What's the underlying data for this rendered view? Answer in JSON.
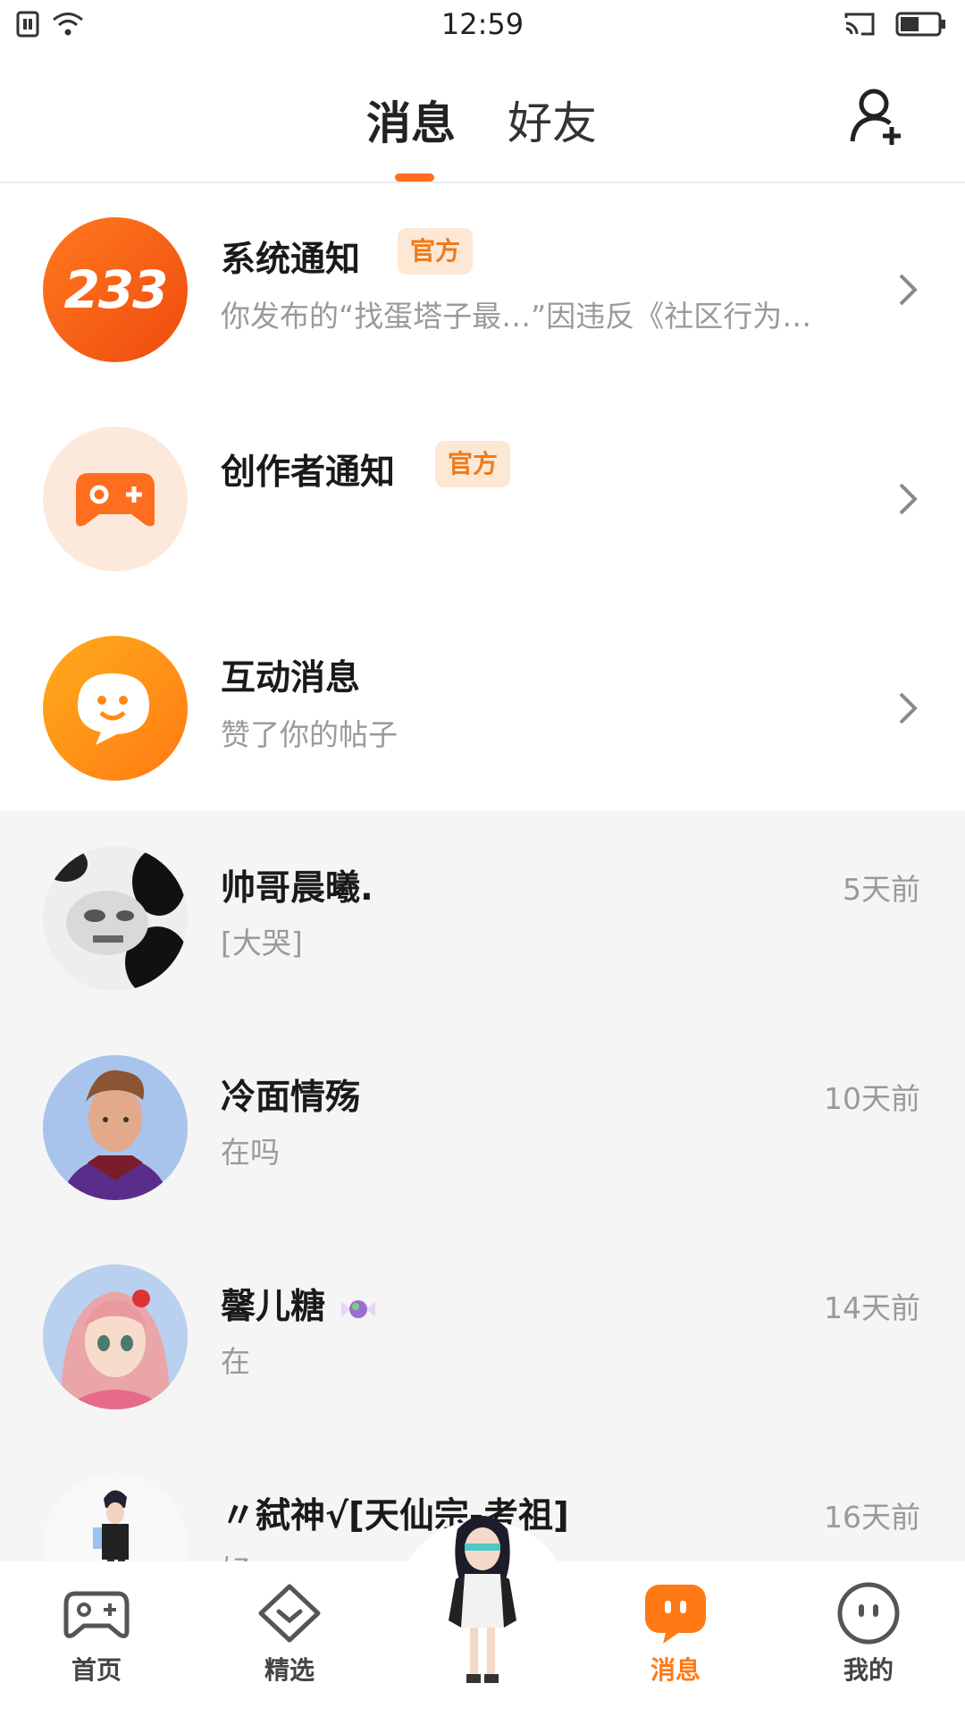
{
  "status_bar": {
    "time": "12:59"
  },
  "header": {
    "tabs": [
      {
        "label": "消息"
      },
      {
        "label": "好友"
      }
    ],
    "active_tab": "消息",
    "add_friend_icon": "add-user-icon"
  },
  "system_rows": [
    {
      "title": "系统通知",
      "badge": "官方",
      "subtitle": "你发布的“找蛋塔子最…”因违反《社区行为…",
      "avatar_text": "233"
    },
    {
      "title": "创作者通知",
      "badge": "官方",
      "subtitle": ""
    },
    {
      "title": "互动消息",
      "subtitle": "赞了你的帖子"
    }
  ],
  "chats": [
    {
      "name": "帅哥晨曦.",
      "message": "[大哭]",
      "time": "5天前"
    },
    {
      "name": "冷面情殇",
      "message": "在吗",
      "time": "10天前"
    },
    {
      "name": "馨儿糖",
      "message": "在",
      "time": "14天前"
    },
    {
      "name": "〃弑神√[天仙宗-考祖]",
      "message": "好",
      "time": "16天前"
    }
  ],
  "bottom_nav": [
    {
      "label": "首页",
      "icon": "gamepad-icon"
    },
    {
      "label": "精选",
      "icon": "heart-icon"
    },
    {
      "label": "",
      "icon": "character-avatar"
    },
    {
      "label": "消息",
      "icon": "message-icon"
    },
    {
      "label": "我的",
      "icon": "face-icon"
    }
  ],
  "colors": {
    "accent": "#ff6d1f",
    "badge_bg": "#fde7d5",
    "badge_text": "#ef7a1a",
    "list_bg": "#f5f5f5"
  }
}
